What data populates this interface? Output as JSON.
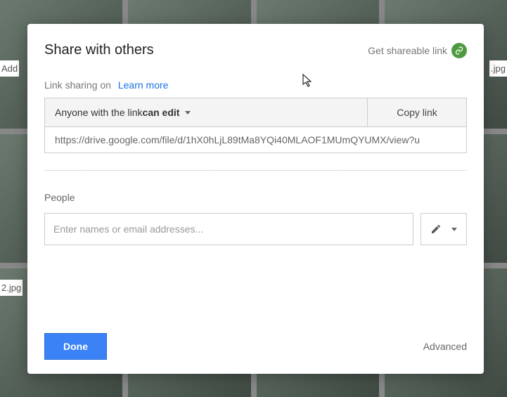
{
  "bgLabels": {
    "add": "Add",
    "jpg1": ".jpg",
    "jpg2": "2.jpg"
  },
  "modal": {
    "title": "Share with others",
    "getLink": "Get shareable link",
    "sharingStatus": "Link sharing on",
    "learnMore": "Learn more",
    "accessPrefix": "Anyone with the link ",
    "accessBold": "can edit",
    "copyLink": "Copy link",
    "url": "https://drive.google.com/file/d/1hX0hLjL89tMa8YQi40MLAOF1MUmQYUMX/view?u",
    "peopleLabel": "People",
    "peoplePlaceholder": "Enter names or email addresses...",
    "done": "Done",
    "advanced": "Advanced"
  }
}
